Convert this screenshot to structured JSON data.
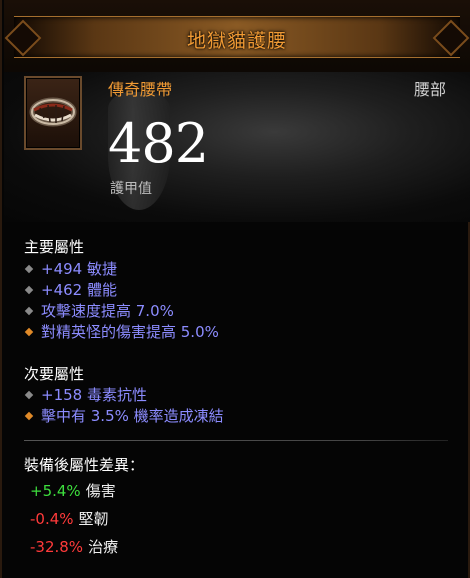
{
  "title": "地獄貓護腰",
  "item": {
    "type": "傳奇腰帶",
    "slot": "腰部",
    "armor": "482",
    "armor_label": "護甲值"
  },
  "primary": {
    "heading": "主要屬性",
    "affixes": [
      {
        "text": "+494 敏捷",
        "bullet": "gray"
      },
      {
        "text": "+462 體能",
        "bullet": "gray"
      },
      {
        "text": "攻擊速度提高 7.0%",
        "bullet": "gray"
      },
      {
        "text": "對精英怪的傷害提高 5.0%",
        "bullet": "orange"
      }
    ]
  },
  "secondary": {
    "heading": "次要屬性",
    "affixes": [
      {
        "text": "+158 毒素抗性",
        "bullet": "gray"
      },
      {
        "text": "擊中有 3.5% 機率造成凍結",
        "bullet": "orange"
      }
    ]
  },
  "diff": {
    "heading": "裝備後屬性差異：",
    "rows": [
      {
        "value": "+5.4%",
        "stat": "傷害",
        "sign": "pos"
      },
      {
        "value": "-0.4%",
        "stat": "堅韌",
        "sign": "neg"
      },
      {
        "value": "-32.8%",
        "stat": "治療",
        "sign": "neg"
      }
    ]
  },
  "colors": {
    "title": "#f09a34",
    "magic_affix": "#8c8cff",
    "positive": "#3dde3d",
    "negative": "#ff3a3a"
  }
}
